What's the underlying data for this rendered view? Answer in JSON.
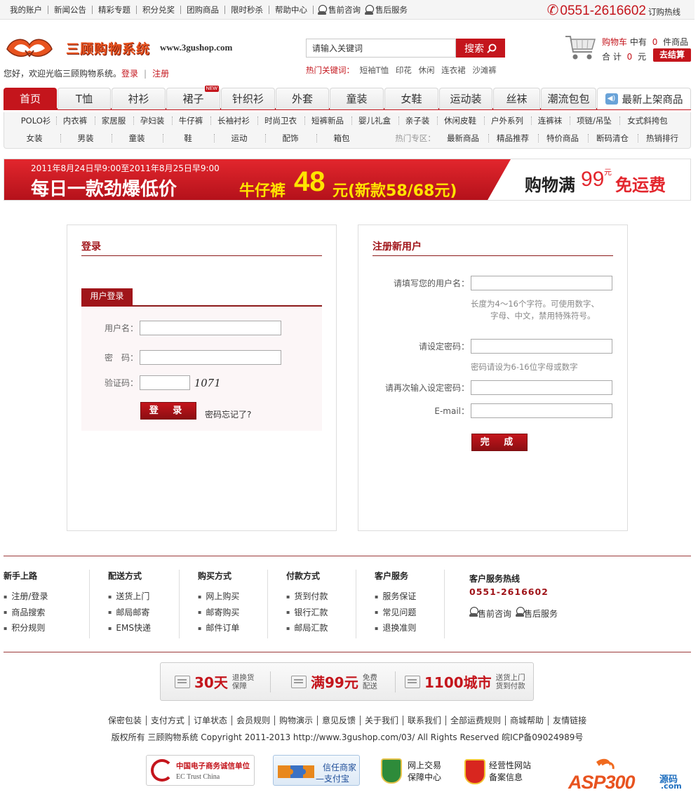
{
  "topbar": {
    "links": [
      "我的账户",
      "新闻公告",
      "精彩专题",
      "积分兑奖",
      "团购商品",
      "限时秒杀",
      "帮助中心"
    ],
    "qq1": "售前咨询",
    "qq2": "售后服务",
    "hotline_number": "0551-2616602",
    "hotline_label": "订购热线"
  },
  "header": {
    "logo_text": "三顾购物系统",
    "logo_url": "www.3gushop.com",
    "welcome": "您好，欢迎光临三顾购物系统。",
    "login_link": "登录",
    "register_link": "注册",
    "search_placeholder": "请输入关键词",
    "search_button": "搜索",
    "hot_label": "热门关键词：",
    "hot_words": [
      "短袖T恤",
      "印花",
      "休闲",
      "连衣裙",
      "沙滩裤"
    ],
    "cart_label": "购物车",
    "cart_has": "中有",
    "cart_count": "0",
    "cart_unit": "件商品",
    "total_label": "合 计",
    "total_value": "0",
    "total_unit": "元",
    "checkout": "去结算"
  },
  "nav": {
    "tabs": [
      "首页",
      "T恤",
      "衬衫",
      "裙子",
      "针织衫",
      "外套",
      "童装",
      "女鞋",
      "运动装",
      "丝袜",
      "潮流包包"
    ],
    "new_badge": "NEW",
    "last": "最新上架商品",
    "sub1": [
      "POLO衫",
      "内衣裤",
      "家居服",
      "孕妇装",
      "牛仔裤",
      "长袖衬衫",
      "时尚卫衣",
      "短裤新品",
      "婴儿礼盒",
      "亲子装",
      "休闲皮鞋",
      "户外系列",
      "连裤袜",
      "项链/吊坠",
      "女式斜挎包"
    ],
    "sub2": [
      "女装",
      "男装",
      "童装",
      "鞋",
      "运动",
      "配饰",
      "箱包"
    ],
    "hot_zone_label": "热门专区：",
    "hot_zone": [
      "最新商品",
      "精品推荐",
      "特价商品",
      "断码清仓",
      "热销排行"
    ]
  },
  "banner": {
    "date": "2011年8月24日早9:00至2011年8月25日早9:00",
    "main": "每日一款劲爆低价",
    "item": "牛仔裤",
    "price": "48",
    "unit": "元(新款58/68元)",
    "right1": "购物满",
    "right2": "99",
    "right3": "元",
    "right4": "免运费"
  },
  "login": {
    "title": "登录",
    "tab": "用户登录",
    "username_label": "用户名：",
    "password_label": "密　码：",
    "captcha_label": "验证码：",
    "captcha_value": "1071",
    "submit": "登 录",
    "forgot": "密码忘记了?"
  },
  "register": {
    "title": "注册新用户",
    "username_label": "请填写您的用户名：",
    "username_hint1": "长度为4～16个字符。可使用数字、",
    "username_hint2": "字母、中文，禁用特殊符号。",
    "password_label": "请设定密码：",
    "password_hint": "密码请设为6-16位字母或数字",
    "password2_label": "请再次输入设定密码：",
    "email_label": "E-mail：",
    "submit": "完 成"
  },
  "footer": {
    "cols": [
      {
        "title": "新手上路",
        "items": [
          "注册/登录",
          "商品搜索",
          "积分规则"
        ]
      },
      {
        "title": "配送方式",
        "items": [
          "送货上门",
          "邮局邮寄",
          "EMS快递"
        ]
      },
      {
        "title": "购买方式",
        "items": [
          "网上购买",
          "邮寄购买",
          "邮件订单"
        ]
      },
      {
        "title": "付款方式",
        "items": [
          "货到付款",
          "银行汇款",
          "邮局汇款"
        ]
      },
      {
        "title": "客户服务",
        "items": [
          "服务保证",
          "常见问题",
          "退换准则"
        ]
      }
    ],
    "service_title": "客户服务热线",
    "service_phone": "0551-2616602",
    "service_qq1": "售前咨询",
    "service_qq2": "售后服务",
    "guarantees": [
      {
        "big": "30天",
        "s1": "退换货",
        "s2": "保障"
      },
      {
        "big": "满99元",
        "s1": "免费",
        "s2": "配送"
      },
      {
        "big": "1100城市",
        "s1": "送货上门",
        "s2": "货到付款"
      }
    ],
    "links": [
      "保密包装",
      "支付方式",
      "订单状态",
      "会员规则",
      "购物演示",
      "意见反馈",
      "关于我们",
      "联系我们",
      "全部运费规则",
      "商城帮助",
      "友情链接"
    ],
    "copyright": "版权所有 三顾购物系统 Copyright 2011-2013 http://www.3gushop.com/03/ All Rights Reserved 皖ICP备09024989号",
    "badges": {
      "ec1": "中国电子商务诚信单位",
      "ec2": "EC Trust China",
      "ap1": "信任商家",
      "ap2": "—支付宝",
      "trade1": "网上交易",
      "trade2": "保障中心",
      "biz1": "经营性网站",
      "biz2": "备案信息",
      "asp1": "ASP300",
      "asp2": "源码",
      "asp3": ".com"
    }
  }
}
